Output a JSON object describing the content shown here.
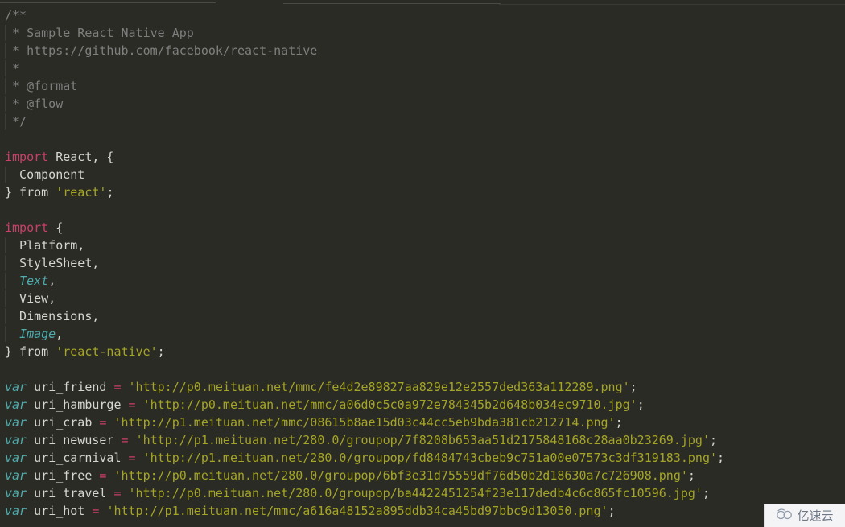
{
  "editor": {
    "language": "javascript",
    "theme": "darcula-olive",
    "colors": {
      "background": "#2b2b26",
      "comment": "#7f7f7f",
      "keyword": "#cb3f68",
      "string": "#a5a525",
      "italic_type": "#4eadad",
      "plain_text": "#d6d6d0",
      "operator": "#cb3f68",
      "indent_guide": "#3d3d36"
    }
  },
  "tabstrip": {
    "visible_fragment": true,
    "tab_count": 3
  },
  "code_lines": [
    {
      "indent_guide": false,
      "tokens": [
        {
          "t": "cmt",
          "s": "/**"
        }
      ]
    },
    {
      "indent_guide": true,
      "tokens": [
        {
          "t": "cmt",
          "s": " * Sample React Native App"
        }
      ]
    },
    {
      "indent_guide": true,
      "tokens": [
        {
          "t": "cmt",
          "s": " * https://github.com/facebook/react-native"
        }
      ]
    },
    {
      "indent_guide": true,
      "tokens": [
        {
          "t": "cmt",
          "s": " *"
        }
      ]
    },
    {
      "indent_guide": true,
      "tokens": [
        {
          "t": "cmt",
          "s": " * @format"
        }
      ]
    },
    {
      "indent_guide": true,
      "tokens": [
        {
          "t": "cmt",
          "s": " * @flow"
        }
      ]
    },
    {
      "indent_guide": true,
      "tokens": [
        {
          "t": "cmt",
          "s": " */"
        }
      ]
    },
    {
      "indent_guide": false,
      "tokens": []
    },
    {
      "indent_guide": false,
      "tokens": [
        {
          "t": "kw",
          "s": "import"
        },
        {
          "t": "plain",
          "s": " React, {"
        }
      ]
    },
    {
      "indent_guide": true,
      "tokens": [
        {
          "t": "plain",
          "s": "  Component"
        }
      ]
    },
    {
      "indent_guide": false,
      "tokens": [
        {
          "t": "plain",
          "s": "} from "
        },
        {
          "t": "str",
          "s": "'react'"
        },
        {
          "t": "plain",
          "s": ";"
        }
      ]
    },
    {
      "indent_guide": false,
      "tokens": []
    },
    {
      "indent_guide": false,
      "tokens": [
        {
          "t": "kw",
          "s": "import"
        },
        {
          "t": "plain",
          "s": " {"
        }
      ]
    },
    {
      "indent_guide": true,
      "tokens": [
        {
          "t": "plain",
          "s": "  Platform,"
        }
      ]
    },
    {
      "indent_guide": true,
      "tokens": [
        {
          "t": "plain",
          "s": "  StyleSheet,"
        }
      ]
    },
    {
      "indent_guide": true,
      "tokens": [
        {
          "t": "plain",
          "s": "  "
        },
        {
          "t": "ital",
          "s": "Text"
        },
        {
          "t": "plain",
          "s": ","
        }
      ]
    },
    {
      "indent_guide": true,
      "tokens": [
        {
          "t": "plain",
          "s": "  View,"
        }
      ]
    },
    {
      "indent_guide": true,
      "tokens": [
        {
          "t": "plain",
          "s": "  Dimensions,"
        }
      ]
    },
    {
      "indent_guide": true,
      "tokens": [
        {
          "t": "plain",
          "s": "  "
        },
        {
          "t": "ital",
          "s": "Image"
        },
        {
          "t": "plain",
          "s": ","
        }
      ]
    },
    {
      "indent_guide": false,
      "tokens": [
        {
          "t": "plain",
          "s": "} from "
        },
        {
          "t": "str",
          "s": "'react-native'"
        },
        {
          "t": "plain",
          "s": ";"
        }
      ]
    },
    {
      "indent_guide": false,
      "tokens": []
    },
    {
      "indent_guide": false,
      "tokens": [
        {
          "t": "var",
          "s": "var"
        },
        {
          "t": "plain",
          "s": " uri_friend "
        },
        {
          "t": "op",
          "s": "="
        },
        {
          "t": "plain",
          "s": " "
        },
        {
          "t": "str",
          "s": "'http://p0.meituan.net/mmc/fe4d2e89827aa829e12e2557ded363a112289.png'"
        },
        {
          "t": "plain",
          "s": ";"
        }
      ]
    },
    {
      "indent_guide": false,
      "tokens": [
        {
          "t": "var",
          "s": "var"
        },
        {
          "t": "plain",
          "s": " uri_hamburge "
        },
        {
          "t": "op",
          "s": "="
        },
        {
          "t": "plain",
          "s": " "
        },
        {
          "t": "str",
          "s": "'http://p0.meituan.net/mmc/a06d0c5c0a972e784345b2d648b034ec9710.jpg'"
        },
        {
          "t": "plain",
          "s": ";"
        }
      ]
    },
    {
      "indent_guide": false,
      "tokens": [
        {
          "t": "var",
          "s": "var"
        },
        {
          "t": "plain",
          "s": " uri_crab "
        },
        {
          "t": "op",
          "s": "="
        },
        {
          "t": "plain",
          "s": " "
        },
        {
          "t": "str",
          "s": "'http://p1.meituan.net/mmc/08615b8ae15d03c44cc5eb9bda381cb212714.png'"
        },
        {
          "t": "plain",
          "s": ";"
        }
      ]
    },
    {
      "indent_guide": false,
      "tokens": [
        {
          "t": "var",
          "s": "var"
        },
        {
          "t": "plain",
          "s": " uri_newuser "
        },
        {
          "t": "op",
          "s": "="
        },
        {
          "t": "plain",
          "s": " "
        },
        {
          "t": "str",
          "s": "'http://p1.meituan.net/280.0/groupop/7f8208b653aa51d2175848168c28aa0b23269.jpg'"
        },
        {
          "t": "plain",
          "s": ";"
        }
      ]
    },
    {
      "indent_guide": false,
      "tokens": [
        {
          "t": "var",
          "s": "var"
        },
        {
          "t": "plain",
          "s": " uri_carnival "
        },
        {
          "t": "op",
          "s": "="
        },
        {
          "t": "plain",
          "s": " "
        },
        {
          "t": "str",
          "s": "'http://p1.meituan.net/280.0/groupop/fd8484743cbeb9c751a00e07573c3df319183.png'"
        },
        {
          "t": "plain",
          "s": ";"
        }
      ]
    },
    {
      "indent_guide": false,
      "tokens": [
        {
          "t": "var",
          "s": "var"
        },
        {
          "t": "plain",
          "s": " uri_free "
        },
        {
          "t": "op",
          "s": "="
        },
        {
          "t": "plain",
          "s": " "
        },
        {
          "t": "str",
          "s": "'http://p0.meituan.net/280.0/groupop/6bf3e31d75559df76d50b2d18630a7c726908.png'"
        },
        {
          "t": "plain",
          "s": ";"
        }
      ]
    },
    {
      "indent_guide": false,
      "tokens": [
        {
          "t": "var",
          "s": "var"
        },
        {
          "t": "plain",
          "s": " uri_travel "
        },
        {
          "t": "op",
          "s": "="
        },
        {
          "t": "plain",
          "s": " "
        },
        {
          "t": "str",
          "s": "'http://p0.meituan.net/280.0/groupop/ba4422451254f23e117dedb4c6c865fc10596.jpg'"
        },
        {
          "t": "plain",
          "s": ";"
        }
      ]
    },
    {
      "indent_guide": false,
      "tokens": [
        {
          "t": "var",
          "s": "var"
        },
        {
          "t": "plain",
          "s": " uri_hot "
        },
        {
          "t": "op",
          "s": "="
        },
        {
          "t": "plain",
          "s": " "
        },
        {
          "t": "str",
          "s": "'http://p1.meituan.net/mmc/a616a48152a895ddb34ca45bd97bbc9d13050.png'"
        },
        {
          "t": "plain",
          "s": ";"
        }
      ]
    }
  ],
  "watermark": {
    "text": "亿速云",
    "icon": "cloud-icon",
    "icon_color": "#8f9bab",
    "text_color": "#6d7785",
    "background": "#f4f4f6"
  }
}
